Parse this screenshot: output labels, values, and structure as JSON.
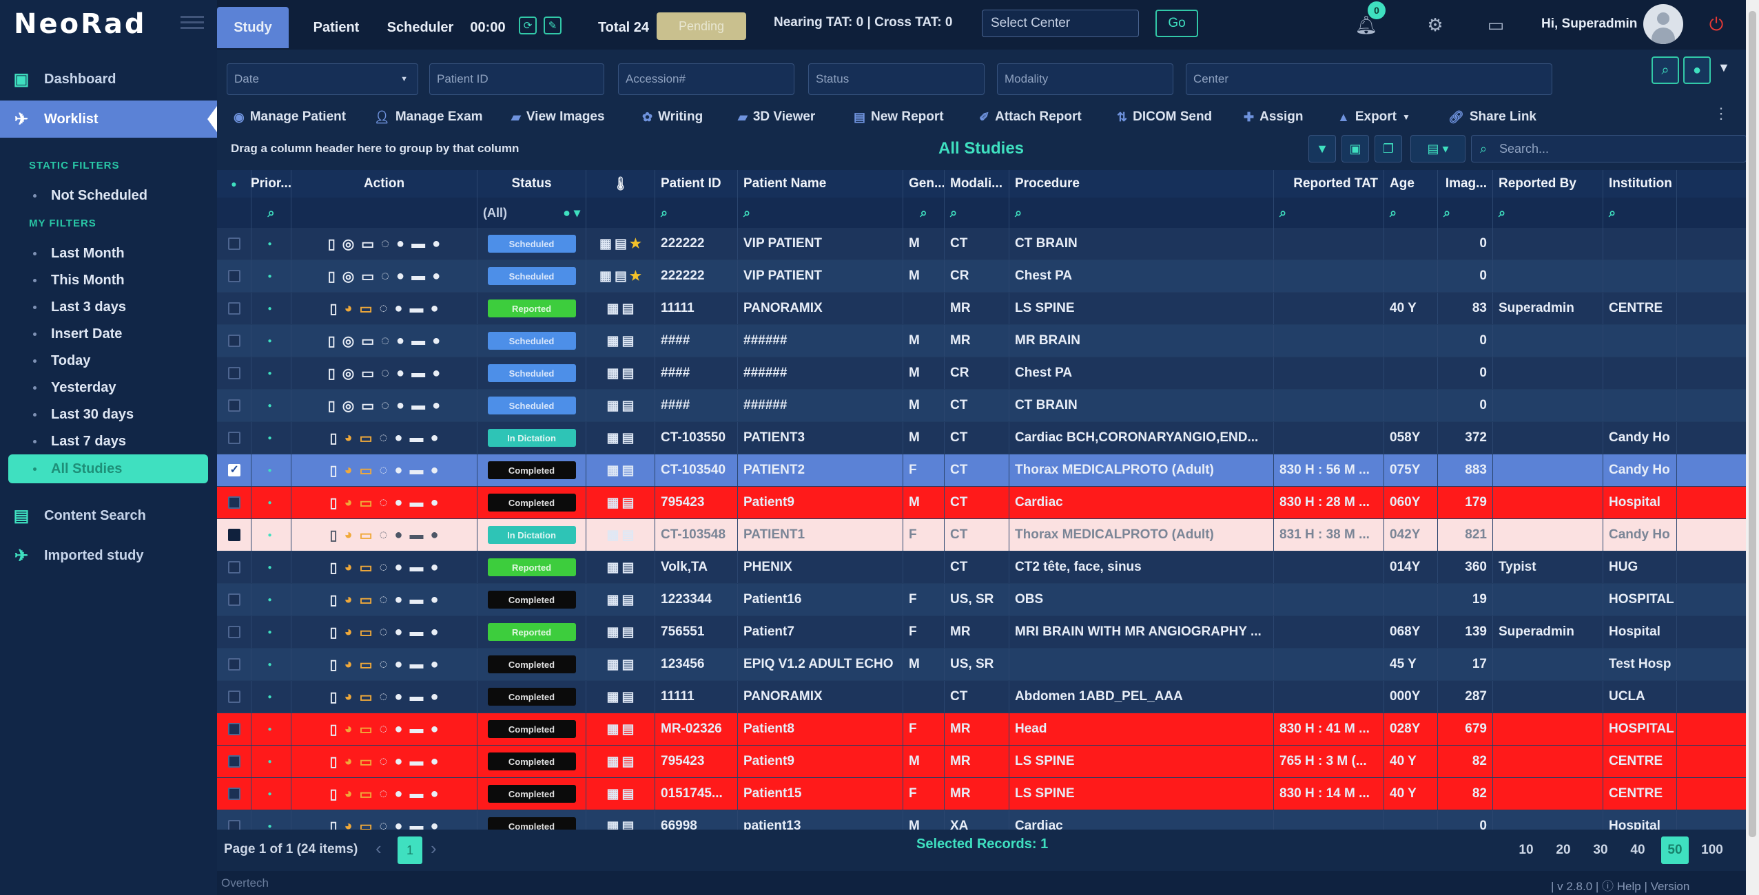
{
  "app": {
    "logo": "NeoRad"
  },
  "sidebar": {
    "items": [
      {
        "label": "Dashboard",
        "icon": "dashboard-icon"
      },
      {
        "label": "Worklist",
        "icon": "worklist-icon"
      },
      {
        "label": "Content Search",
        "icon": "content-search-icon"
      },
      {
        "label": "Imported study",
        "icon": "imported-study-icon"
      }
    ],
    "static_filters_header": "STATIC FILTERS",
    "static_filters": [
      "Not Scheduled"
    ],
    "my_filters_header": "MY FILTERS",
    "my_filters": [
      "Last Month",
      "This Month",
      "Last 3 days",
      "Insert Date",
      "Today",
      "Yesterday",
      "Last 30 days",
      "Last 7 days",
      "All Studies"
    ],
    "selected_filter": "All Studies"
  },
  "topbar": {
    "tabs": [
      "Study",
      "Patient",
      "Scheduler"
    ],
    "timer": "00:00",
    "total": "Total 24",
    "status_pill": "Pending",
    "tat": "Nearing TAT: 0 | Cross TAT: 0",
    "center_placeholder": "Select Center",
    "go_label": "Go",
    "notif_count": "0",
    "user": "Hi, Superadmin"
  },
  "filters": {
    "date": "Date",
    "patient_id": "Patient ID",
    "accession": "Accession#",
    "status": "Status",
    "modality": "Modality",
    "center": "Center"
  },
  "toolbar": [
    "Manage Patient",
    "Manage Exam",
    "View Images",
    "Writing",
    "3D Viewer",
    "New Report",
    "Attach Report",
    "DICOM Send",
    "Assign",
    "Export",
    "Share Link"
  ],
  "grid": {
    "group_hint": "Drag a column header here to group by that column",
    "title": "All Studies",
    "search_placeholder": "Search...",
    "columns": [
      "Prior...",
      "Action",
      "Status",
      "",
      "Patient ID",
      "Patient Name",
      "Gen...",
      "Modali...",
      "Procedure",
      "Reported TAT",
      "Age",
      "Imag...",
      "Reported By",
      "Institution"
    ],
    "status_filter": "(All)",
    "rows": [
      {
        "style": "r0",
        "status": "Scheduled",
        "st": "st-sched",
        "pid": "222222",
        "name": "VIP PATIENT",
        "gen": "M",
        "mod": "CT",
        "proc": "CT BRAIN",
        "tat": "",
        "age": "",
        "img": "0",
        "by": "",
        "inst": "",
        "star": true
      },
      {
        "style": "r1",
        "status": "Scheduled",
        "st": "st-sched",
        "pid": "222222",
        "name": "VIP PATIENT",
        "gen": "M",
        "mod": "CR",
        "proc": "Chest PA",
        "tat": "",
        "age": "",
        "img": "0",
        "by": "",
        "inst": "",
        "star": true
      },
      {
        "style": "r0",
        "status": "Reported",
        "st": "st-rep",
        "pid": "11111",
        "name": "PANORAMIX",
        "gen": "",
        "mod": "MR",
        "proc": "LS SPINE",
        "tat": "",
        "age": "40 Y",
        "img": "83",
        "by": "Superadmin",
        "inst": "CENTRE",
        "star": false
      },
      {
        "style": "r1",
        "status": "Scheduled",
        "st": "st-sched",
        "pid": "####",
        "name": "######",
        "gen": "M",
        "mod": "MR",
        "proc": "MR BRAIN",
        "tat": "",
        "age": "",
        "img": "0",
        "by": "",
        "inst": "",
        "star": false
      },
      {
        "style": "r0",
        "status": "Scheduled",
        "st": "st-sched",
        "pid": "####",
        "name": "######",
        "gen": "M",
        "mod": "CR",
        "proc": "Chest PA",
        "tat": "",
        "age": "",
        "img": "0",
        "by": "",
        "inst": "",
        "star": false
      },
      {
        "style": "r1",
        "status": "Scheduled",
        "st": "st-sched",
        "pid": "####",
        "name": "######",
        "gen": "M",
        "mod": "CT",
        "proc": "CT BRAIN",
        "tat": "",
        "age": "",
        "img": "0",
        "by": "",
        "inst": "",
        "star": false
      },
      {
        "style": "r0",
        "status": "In Dictation",
        "st": "st-prog",
        "pid": "CT-103550",
        "name": "PATIENT3",
        "gen": "M",
        "mod": "CT",
        "proc": "Cardiac BCH,CORONARYANGIO,END...",
        "tat": "",
        "age": "058Y",
        "img": "372",
        "by": "",
        "inst": "Candy Ho",
        "star": false
      },
      {
        "style": "selrow",
        "status": "Completed",
        "st": "st-comp",
        "pid": "CT-103540",
        "name": "PATIENT2",
        "gen": "F",
        "mod": "CT",
        "proc": "Thorax MEDICALPROTO (Adult)",
        "tat": "830 H : 56 M ...",
        "age": "075Y",
        "img": "883",
        "by": "",
        "inst": "Candy Ho",
        "star": false
      },
      {
        "style": "redrow",
        "status": "Completed",
        "st": "st-comp",
        "pid": "795423",
        "name": "Patient9",
        "gen": "M",
        "mod": "CT",
        "proc": "Cardiac",
        "tat": "830 H : 28 M ...",
        "age": "060Y",
        "img": "179",
        "by": "",
        "inst": "Hospital",
        "star": false
      },
      {
        "style": "pinkrow",
        "status": "In Dictation",
        "st": "st-prog",
        "pid": "CT-103548",
        "name": "PATIENT1",
        "gen": "F",
        "mod": "CT",
        "proc": "Thorax MEDICALPROTO (Adult)",
        "tat": "831 H : 38 M ...",
        "age": "042Y",
        "img": "821",
        "by": "",
        "inst": "Candy Ho",
        "star": false
      },
      {
        "style": "r0",
        "status": "Reported",
        "st": "st-rep",
        "pid": "Volk,TA",
        "name": "PHENIX",
        "gen": "",
        "mod": "CT",
        "proc": "CT2 tête, face, sinus",
        "tat": "",
        "age": "014Y",
        "img": "360",
        "by": "Typist",
        "inst": "HUG",
        "star": false
      },
      {
        "style": "r1",
        "status": "Completed",
        "st": "st-comp",
        "pid": "1223344",
        "name": "Patient16",
        "gen": "F",
        "mod": "US, SR",
        "proc": "OBS",
        "tat": "",
        "age": "",
        "img": "19",
        "by": "",
        "inst": "HOSPITAL",
        "star": false
      },
      {
        "style": "r0",
        "status": "Reported",
        "st": "st-rep",
        "pid": "756551",
        "name": "Patient7",
        "gen": "F",
        "mod": "MR",
        "proc": "MRI BRAIN WITH MR ANGIOGRAPHY ...",
        "tat": "",
        "age": "068Y",
        "img": "139",
        "by": "Superadmin",
        "inst": "Hospital",
        "star": false
      },
      {
        "style": "r1",
        "status": "Completed",
        "st": "st-comp",
        "pid": "123456",
        "name": "EPIQ V1.2 ADULT ECHO",
        "gen": "M",
        "mod": "US, SR",
        "proc": "",
        "tat": "",
        "age": "45 Y",
        "img": "17",
        "by": "",
        "inst": "Test Hosp",
        "star": false
      },
      {
        "style": "r0",
        "status": "Completed",
        "st": "st-comp",
        "pid": "11111",
        "name": "PANORAMIX",
        "gen": "",
        "mod": "CT",
        "proc": "Abdomen 1ABD_PEL_AAA",
        "tat": "",
        "age": "000Y",
        "img": "287",
        "by": "",
        "inst": "UCLA",
        "star": false
      },
      {
        "style": "redrow",
        "status": "Completed",
        "st": "st-comp",
        "pid": "MR-02326",
        "name": "Patient8",
        "gen": "F",
        "mod": "MR",
        "proc": "Head",
        "tat": "830 H : 41 M ...",
        "age": "028Y",
        "img": "679",
        "by": "",
        "inst": "HOSPITAL",
        "star": false
      },
      {
        "style": "redrow",
        "status": "Completed",
        "st": "st-comp",
        "pid": "795423",
        "name": "Patient9",
        "gen": "M",
        "mod": "MR",
        "proc": "LS SPINE",
        "tat": "765 H : 3 M (...",
        "age": "40 Y",
        "img": "82",
        "by": "",
        "inst": "CENTRE",
        "star": false
      },
      {
        "style": "redrow",
        "status": "Completed",
        "st": "st-comp",
        "pid": "0151745...",
        "name": "Patient15",
        "gen": "F",
        "mod": "MR",
        "proc": "LS SPINE",
        "tat": "830 H : 14 M ...",
        "age": "40 Y",
        "img": "82",
        "by": "",
        "inst": "CENTRE",
        "star": false
      },
      {
        "style": "r1",
        "status": "Completed",
        "st": "st-comp",
        "pid": "66998",
        "name": "patient13",
        "gen": "M",
        "mod": "XA",
        "proc": "Cardiac",
        "tat": "",
        "age": "",
        "img": "0",
        "by": "",
        "inst": "Hospital",
        "star": false
      }
    ]
  },
  "pager": {
    "info": "Page 1 of 1 (24 items)",
    "page": "1",
    "selected": "Selected Records: 1",
    "sizes": [
      "10",
      "20",
      "30",
      "40",
      "50",
      "100"
    ],
    "active_size": "50"
  },
  "footer": {
    "company": "Overtech",
    "version": "| v 2.8.0 | ⓘ Help | Version"
  }
}
